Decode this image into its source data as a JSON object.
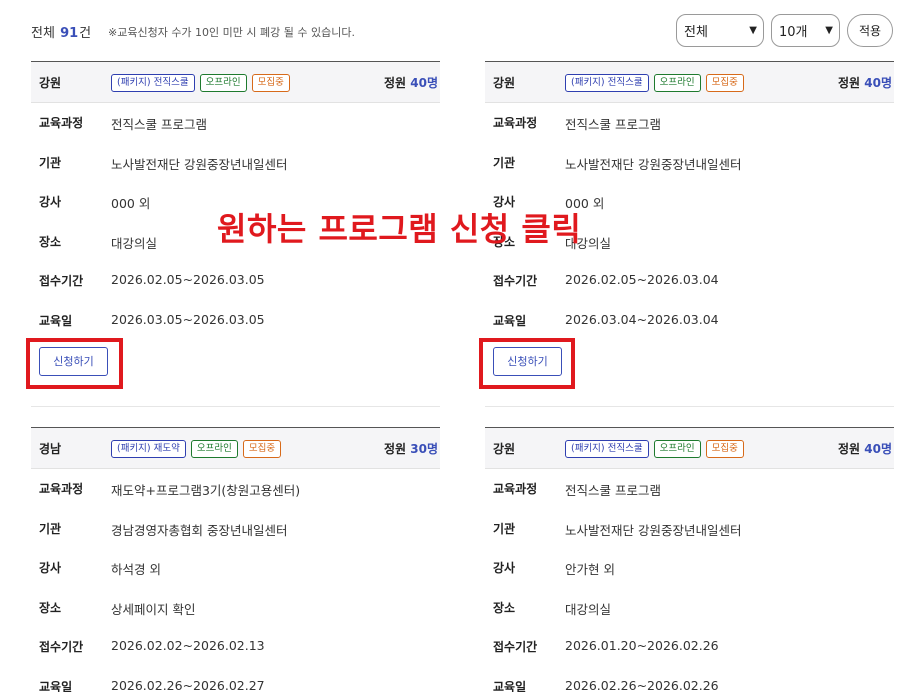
{
  "header": {
    "total_label": "전체",
    "total_count": "91",
    "total_unit": "건",
    "notice": "※교육신청자 수가 10인 미만 시 폐강 될 수 있습니다.",
    "filter_select": "전체",
    "count_select": "10개",
    "apply_label": "적용"
  },
  "labels": {
    "course": "교육과정",
    "org": "기관",
    "instructor": "강사",
    "place": "장소",
    "period": "접수기간",
    "date": "교육일",
    "quota_prefix": "정원",
    "apply_button": "신청하기"
  },
  "cards": [
    {
      "region": "강원",
      "tags": [
        "(패키지) 전직스쿨",
        "오프라인",
        "모집중"
      ],
      "quota_num": "40명",
      "course": "전직스쿨 프로그램",
      "org": "노사발전재단 강원중장년내일센터",
      "instructor": "000 외",
      "place": "대강의실",
      "period": "2026.02.05~2026.03.05",
      "date": "2026.03.05~2026.03.05"
    },
    {
      "region": "강원",
      "tags": [
        "(패키지) 전직스쿨",
        "오프라인",
        "모집중"
      ],
      "quota_num": "40명",
      "course": "전직스쿨 프로그램",
      "org": "노사발전재단 강원중장년내일센터",
      "instructor": "000 외",
      "place": "대강의실",
      "period": "2026.02.05~2026.03.04",
      "date": "2026.03.04~2026.03.04"
    },
    {
      "region": "경남",
      "tags": [
        "(패키지) 재도약",
        "오프라인",
        "모집중"
      ],
      "quota_num": "30명",
      "course": "재도약+프로그램3기(창원고용센터)",
      "org": "경남경영자총협회 중장년내일센터",
      "instructor": "하석경 외",
      "place": "상세페이지 확인",
      "period": "2026.02.02~2026.02.13",
      "date": "2026.02.26~2026.02.27"
    },
    {
      "region": "강원",
      "tags": [
        "(패키지) 전직스쿨",
        "오프라인",
        "모집중"
      ],
      "quota_num": "40명",
      "course": "전직스쿨 프로그램",
      "org": "노사발전재단 강원중장년내일센터",
      "instructor": "안가현 외",
      "place": "대강의실",
      "period": "2026.01.20~2026.02.26",
      "date": "2026.02.26~2026.02.26"
    }
  ],
  "annotation": "원하는 프로그램 신청 클릭",
  "colors": {
    "accent": "#3a4fb8",
    "highlight": "#e0191e",
    "tag_green": "#1e7a2e",
    "tag_orange": "#d76a1a"
  }
}
